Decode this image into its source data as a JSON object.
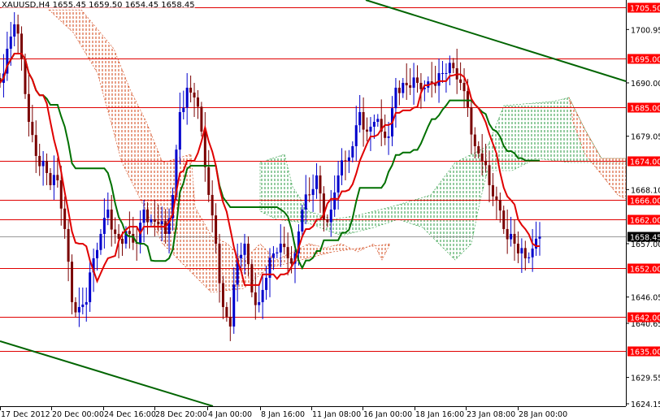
{
  "header": {
    "symbol": "XAUUSD,H4",
    "ohlc": "1655.45 1659.50 1654.45 1658.45"
  },
  "chart_data": {
    "type": "candlestick",
    "title": "XAUUSD,H4",
    "ylim": [
      1624.15,
      1705.5
    ],
    "y_ticks": [
      "1700.95",
      "1690.00",
      "1679.05",
      "1668.10",
      "1657.00",
      "1646.05",
      "1640.65",
      "1629.55",
      "1624.15"
    ],
    "x_ticks": [
      "17 Dec 2012",
      "20 Dec 00:00",
      "24 Dec 16:00",
      "28 Dec 20:00",
      "4 Jan 00:00",
      "8 Jan 16:00",
      "11 Jan 08:00",
      "16 Jan 00:00",
      "18 Jan 16:00",
      "23 Jan 08:00",
      "28 Jan 00:00"
    ],
    "levels": [
      {
        "value": 1705.5,
        "label": "1705.50"
      },
      {
        "value": 1695.0,
        "label": "1695.00"
      },
      {
        "value": 1685.0,
        "label": "1685.00"
      },
      {
        "value": 1674.0,
        "label": "1674.00"
      },
      {
        "value": 1666.0,
        "label": "1666.00"
      },
      {
        "value": 1662.0,
        "label": "1662.00"
      },
      {
        "value": 1652.0,
        "label": "1652.00"
      },
      {
        "value": 1642.0,
        "label": "1642.00"
      },
      {
        "value": 1635.0,
        "label": "1635.00"
      }
    ],
    "current_price": {
      "value": 1658.45,
      "label": "1658.45"
    },
    "closes": [
      1690,
      1697,
      1702,
      1695,
      1682,
      1675,
      1674,
      1669,
      1670,
      1660,
      1645,
      1644,
      1645,
      1654,
      1659,
      1664,
      1659,
      1657,
      1659,
      1657,
      1664,
      1662,
      1661,
      1659,
      1667,
      1684,
      1689,
      1687,
      1680,
      1667,
      1657,
      1644,
      1640,
      1654,
      1657,
      1647,
      1645,
      1650,
      1655,
      1657,
      1654,
      1655,
      1664,
      1667,
      1671,
      1662,
      1664,
      1671,
      1674,
      1677,
      1684,
      1680,
      1682,
      1680,
      1679,
      1689,
      1690,
      1689,
      1690,
      1689,
      1690,
      1692,
      1692,
      1693,
      1690,
      1685,
      1677,
      1674,
      1669,
      1666,
      1660,
      1659,
      1655,
      1654,
      1656,
      1658.45
    ],
    "colors": {
      "level": "#e00000",
      "label_bg": "#ff0000",
      "bull": "#0000cc",
      "bear": "#7a0000",
      "fast_line": "#e00000",
      "slow_line": "#007000",
      "trend": "#006400",
      "cloud_bear": "#d04010",
      "cloud_bull": "#2a9a40"
    }
  }
}
